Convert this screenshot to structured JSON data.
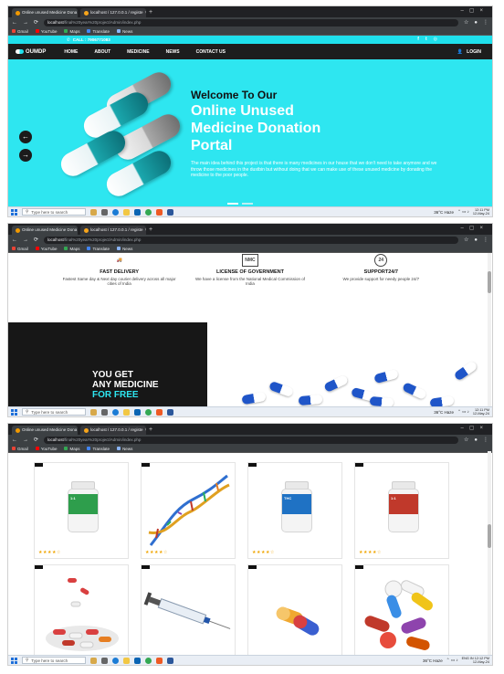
{
  "browser": {
    "tabs": [
      {
        "label": "Online unused Medicine Dona",
        "active": true
      },
      {
        "label": "localhost / 127.0.0.1 / registe",
        "active": false
      }
    ],
    "new_tab": "+",
    "url_host": "localhost",
    "url_path": "/final%20year%20project/Admin/index.php",
    "bookmarks": [
      {
        "label": "Gmail",
        "color": "#ea4335"
      },
      {
        "label": "YouTube",
        "color": "#ff0000"
      },
      {
        "label": "Maps",
        "color": "#34a853"
      },
      {
        "label": "Translate",
        "color": "#4285f4"
      },
      {
        "label": "News",
        "color": "#5f6368"
      }
    ]
  },
  "taskbar": {
    "search_placeholder": "Type here to search",
    "weather": "36°C  Haze",
    "clock_panel1": {
      "time": "12:11 PM",
      "date": "12-May-24"
    },
    "clock_panel2": {
      "time": "12:11 PM",
      "date": "12-May-24"
    },
    "clock_panel3": {
      "time": "12:12 PM",
      "date": "12-May-24"
    },
    "lang": "ENG IN"
  },
  "site": {
    "call": "CALL : 7906771083",
    "logo": "OUMDP",
    "nav": [
      "HOME",
      "ABOUT",
      "MEDICINE",
      "NEWS",
      "CONTACT US"
    ],
    "login": "LOGIN",
    "hero": {
      "welcome": "Welcome To Our",
      "title_line1": "Online Unused",
      "title_line2": "Medicine Donation",
      "title_line3": "Portal",
      "description": "The main idea behind this project is that there is many medicines in our house that we don't need to take anymore and we throw those medicines in the dustbin but without doing that we can make use of these unused medicine by donating the medicine to the poor people."
    },
    "features": [
      {
        "icon": "truck-icon",
        "icon_text": "",
        "title": "FAST DELIVERY",
        "desc": "Fastest Same day & Next day courier delivery across all major cities of India"
      },
      {
        "icon": "license-icon",
        "icon_text": "NMC",
        "title": "LICENSE OF GOVERNMENT",
        "desc": "We have a license from the National Medical Commission of India"
      },
      {
        "icon": "support-24-icon",
        "icon_text": "24",
        "title": "SUPPORT24/7",
        "desc": "We provide support for needy people 24/7"
      }
    ],
    "promo": {
      "line1": "YOU GET",
      "line2": "ANY MEDICINE",
      "line3": "FOR FREE"
    },
    "products": [
      {
        "image": "medicine-bottle-green",
        "stars": "★★★★☆",
        "accent": "#2e9e4c"
      },
      {
        "image": "dna-helix",
        "stars": "★★★★☆",
        "accent": "#c0392b"
      },
      {
        "image": "medicine-bottle-blue",
        "stars": "★★★★☆",
        "accent": "#1f72c4"
      },
      {
        "image": "medicine-bottle-red",
        "stars": "★★★★☆",
        "accent": "#c0392b"
      },
      {
        "image": "capsule-pile",
        "stars": "",
        "accent": "#d94040"
      },
      {
        "image": "syringe",
        "stars": "",
        "accent": "#2255aa"
      },
      {
        "image": "capsule-pair",
        "stars": "",
        "accent": "#3a5fd0"
      },
      {
        "image": "mixed-pills",
        "stars": "",
        "accent": "#8e44ad"
      }
    ]
  },
  "colors": {
    "accent": "#2ee6f0",
    "nav_bg": "#1d1d1d",
    "browser_bg": "#202124"
  }
}
